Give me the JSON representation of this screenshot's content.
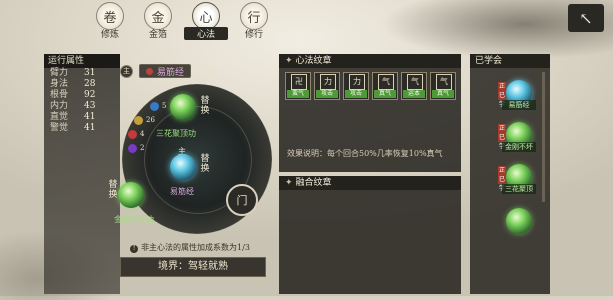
{
  "tabs": [
    {
      "label": "修炼",
      "glyph": "卷",
      "active": false
    },
    {
      "label": "金箔",
      "glyph": "金",
      "active": false
    },
    {
      "label": "心法",
      "glyph": "心",
      "active": true
    },
    {
      "label": "修行",
      "glyph": "行",
      "active": false
    }
  ],
  "close_icon": "↖",
  "attributes": {
    "title": "运行属性",
    "rows": [
      {
        "name": "臂力",
        "value": "31"
      },
      {
        "name": "身法",
        "value": "28"
      },
      {
        "name": "根骨",
        "value": "92"
      },
      {
        "name": "内力",
        "value": "43"
      },
      {
        "name": "直觉",
        "value": "41"
      },
      {
        "name": "警觉",
        "value": "41"
      }
    ]
  },
  "main_skill": {
    "badge": "主",
    "name": "易筋经",
    "status": "人绝"
  },
  "orbit": {
    "top_skill_label": "三花聚顶功",
    "center_skill_badge": "主",
    "center_skill_label": "易筋经",
    "bottom_skill_label": "金刚不坏功",
    "swap_label": "替换",
    "mini_numbers": [
      "5",
      "26",
      "4",
      "2"
    ],
    "gate_icon": "门"
  },
  "notice": "非主心法的属性加成系数为1/3",
  "notice_icon": "!",
  "realm": "境界：驾轻就熟",
  "xinfa_panel": {
    "title": "心法纹章",
    "glyphs": [
      {
        "glyph": "卍",
        "tag": "蛮气"
      },
      {
        "glyph": "力",
        "tag": "攻击"
      },
      {
        "glyph": "力",
        "tag": "攻击"
      },
      {
        "glyph": "气",
        "tag": "真气"
      },
      {
        "glyph": "气",
        "tag": "运本"
      },
      {
        "glyph": "气",
        "tag": "真气"
      }
    ],
    "effect": "效果说明：每个回合50%几率恢复10%真气"
  },
  "fusion_panel": {
    "title": "融合纹章"
  },
  "learned_panel": {
    "title": "已学会",
    "items": [
      {
        "tag": "正已学",
        "label": "易筋经",
        "color": "blue"
      },
      {
        "tag": "正已学",
        "label": "金刚不坏",
        "color": "green"
      },
      {
        "tag": "正已学",
        "label": "三花聚顶",
        "color": "green"
      },
      {
        "tag": "",
        "label": "",
        "color": "green"
      }
    ]
  }
}
